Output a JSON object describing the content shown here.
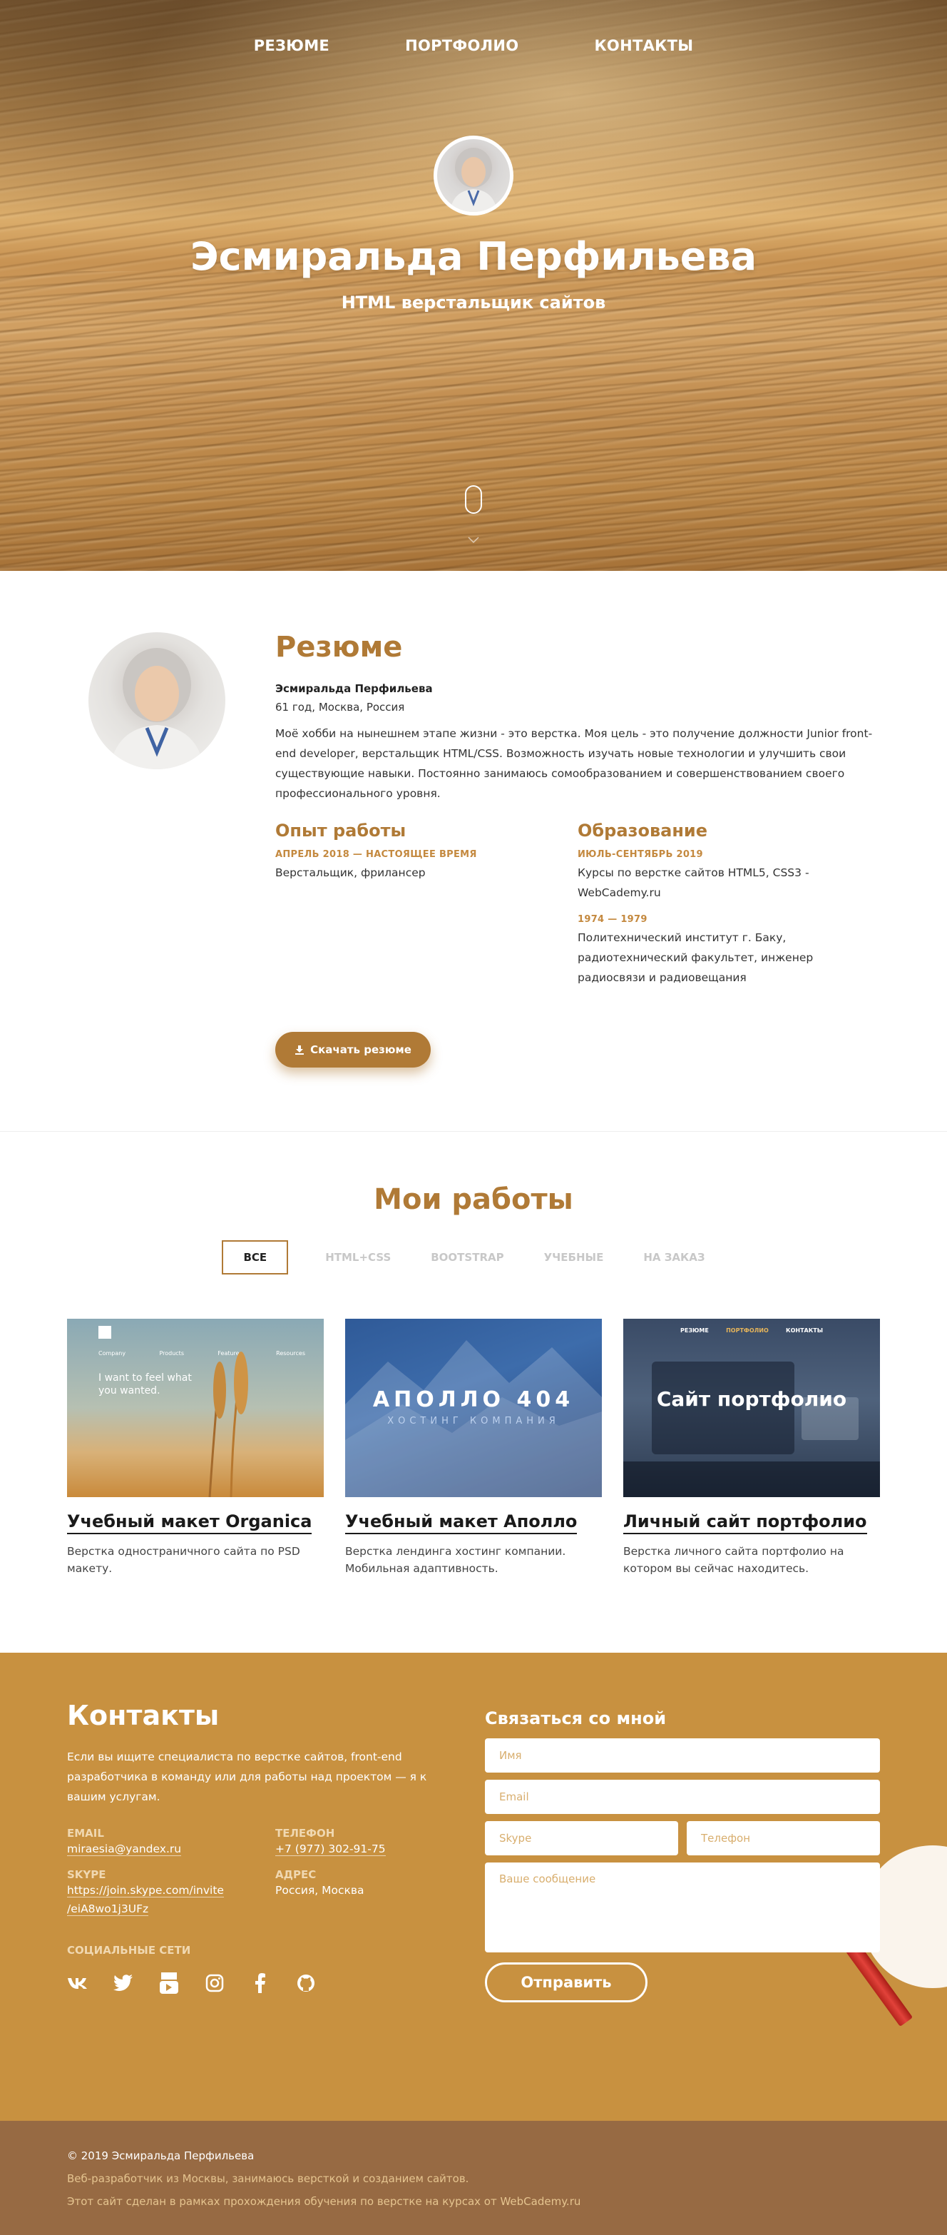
{
  "nav": [
    {
      "label": "РЕЗЮМЕ"
    },
    {
      "label": "ПОРТФОЛИО"
    },
    {
      "label": "КОНТАКТЫ"
    }
  ],
  "hero": {
    "name": "Эсмиральда Перфильева",
    "role": "HTML верстальщик сайтов"
  },
  "resume": {
    "title": "Резюме",
    "name": "Эсмиральда Перфильева",
    "meta": "61 год, Москва, Россия",
    "bio": "Моё хобби на нынешнем этапе жизни - это верстка. Моя цель - это получение должности Junior front-end developer, верстальщик HTML/CSS. Возможность изучать новые технологии и улучшить свои существующие навыки. Постоянно занимаюсь сомообразованием и совершенствованием своего профессионального уровня.",
    "experience_title": "Опыт работы",
    "experience": [
      {
        "period": "АПРЕЛЬ 2018 — НАСТОЯЩЕЕ ВРЕМЯ",
        "text": "Верстальщик, фрилансер"
      }
    ],
    "education_title": "Образование",
    "education": [
      {
        "period": "ИЮЛЬ-СЕНТЯБРЬ 2019",
        "text": "Курсы по верстке сайтов HTML5, CSS3 - WebCademy.ru"
      },
      {
        "period": "1974 — 1979",
        "text": "Политехнический институт г. Баку, радиотехнический факультет, инженер радиосвязи и радиовещания"
      }
    ],
    "download_label": "Скачать резюме"
  },
  "portfolio": {
    "title": "Мои работы",
    "filters": [
      {
        "label": "ВСЕ"
      },
      {
        "label": "HTML+CSS"
      },
      {
        "label": "BOOTSTRAP"
      },
      {
        "label": "УЧЕБНЫЕ"
      },
      {
        "label": "НА ЗАКАЗ"
      }
    ],
    "cards": [
      {
        "title": "Учебный макет Organica",
        "desc": "Верстка одностраничного сайта по PSD макету.",
        "thumb_text": "I want to feel what you wanted.",
        "thumb_nav": [
          "Company",
          "Products",
          "Features",
          "Resources"
        ]
      },
      {
        "title": "Учебный макет Аполло",
        "desc": "Верстка лендинга хостинг компании. Мобильная адаптивность.",
        "thumb_title": "АПОЛЛО 404",
        "thumb_sub": "ХОСТИНГ КОМПАНИЯ"
      },
      {
        "title": "Личный сайт портфолио",
        "desc": "Верстка личного сайта портфолио на котором вы сейчас находитесь.",
        "thumb_title": "Сайт портфолио",
        "thumb_nav": [
          "РЕЗЮМЕ",
          "ПОРТФОЛИО",
          "КОНТАКТЫ"
        ]
      }
    ]
  },
  "contacts": {
    "title": "Контакты",
    "intro": "Если вы ищите специалиста по верстке сайтов, front-end разработчика в команду или для работы над проектом — я к вашим услугам.",
    "email_label": "EMAIL",
    "email": "miraesia@yandex.ru",
    "phone_label": "ТЕЛЕФОН",
    "phone": "+7 (977) 302-91-75",
    "skype_label": "SKYPE",
    "skype_line1": "https://join.skype.com/invite",
    "skype_line2": "/eiA8wo1j3UFz",
    "address_label": "АДРЕС",
    "address": "Россия, Москва",
    "social_label": "СОЦИАЛЬНЫЕ СЕТИ",
    "form_title": "Связаться со мной",
    "form": {
      "name_placeholder": "Имя",
      "email_placeholder": "Email",
      "skype_placeholder": "Skype",
      "phone_placeholder": "Телефон",
      "message_placeholder": "Ваше сообщение",
      "submit_label": "Отправить"
    },
    "social_icons": [
      "vk-icon",
      "twitter-icon",
      "youtube-icon",
      "instagram-icon",
      "facebook-icon",
      "github-icon"
    ]
  },
  "footer": {
    "copyright": "© 2019 Эсмиральда Перфильева",
    "line1": "Веб-разработчик из Москвы, занимаюсь версткой и созданием сайтов.",
    "line2": "Этот сайт сделан в рамках прохождения обучения по верстке на курсах от WebCademy.ru"
  },
  "colors": {
    "accent": "#b07a36",
    "contacts_bg": "#c89140",
    "footer_bg": "#976a43"
  }
}
